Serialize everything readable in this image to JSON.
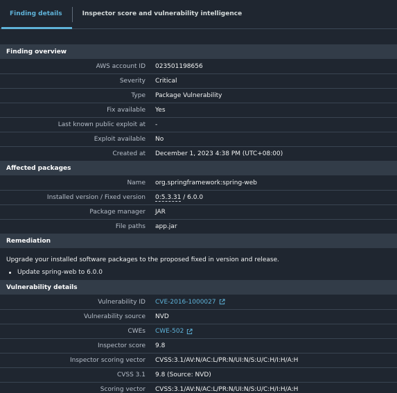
{
  "tabs": [
    {
      "label": "Finding details"
    },
    {
      "label": "Inspector score and vulnerability intelligence"
    }
  ],
  "finding_overview": {
    "title": "Finding overview",
    "rows": [
      {
        "label": "AWS account ID",
        "value": "023501198656"
      },
      {
        "label": "Severity",
        "value": "Critical"
      },
      {
        "label": "Type",
        "value": "Package Vulnerability"
      },
      {
        "label": "Fix available",
        "value": "Yes"
      },
      {
        "label": "Last known public exploit at",
        "value": "-"
      },
      {
        "label": "Exploit available",
        "value": "No"
      },
      {
        "label": "Created at",
        "value": "December 1, 2023 4:38 PM (UTC+08:00)"
      }
    ]
  },
  "affected_packages": {
    "title": "Affected packages",
    "name_label": "Name",
    "name_value": "org.springframework:spring-web",
    "version_label": "Installed version / Fixed version",
    "installed_version": "0:5.3.31",
    "version_sep": " / ",
    "fixed_version": "6.0.0",
    "manager_label": "Package manager",
    "manager_value": "JAR",
    "paths_label": "File paths",
    "paths_value": "app.jar"
  },
  "remediation": {
    "title": "Remediation",
    "text": "Upgrade your installed software packages to the proposed fixed in version and release.",
    "bullet": "Update spring-web to 6.0.0"
  },
  "vulnerability_details": {
    "title": "Vulnerability details",
    "id_label": "Vulnerability ID",
    "id_value": "CVE-2016-1000027",
    "source_label": "Vulnerability source",
    "source_value": "NVD",
    "cwes_label": "CWEs",
    "cwes_value": "CWE-502",
    "score_label": "Inspector score",
    "score_value": "9.8",
    "vector_label": "Inspector scoring vector",
    "vector_value": "CVSS:3.1/AV:N/AC:L/PR:N/UI:N/S:U/C:H/I:H/A:H",
    "cvss_label": "CVSS 3.1",
    "cvss_value": "9.8 (Source: NVD)",
    "scoring_label": "Scoring vector",
    "scoring_value": "CVSS:3.1/AV:N/AC:L/PR:N/UI:N/S:U/C:H/I:H/A:H"
  },
  "colors": {
    "background": "#1f2630",
    "section_header": "#323c48",
    "accent_link": "#5fb3d9",
    "label_text": "#b6bec9"
  }
}
